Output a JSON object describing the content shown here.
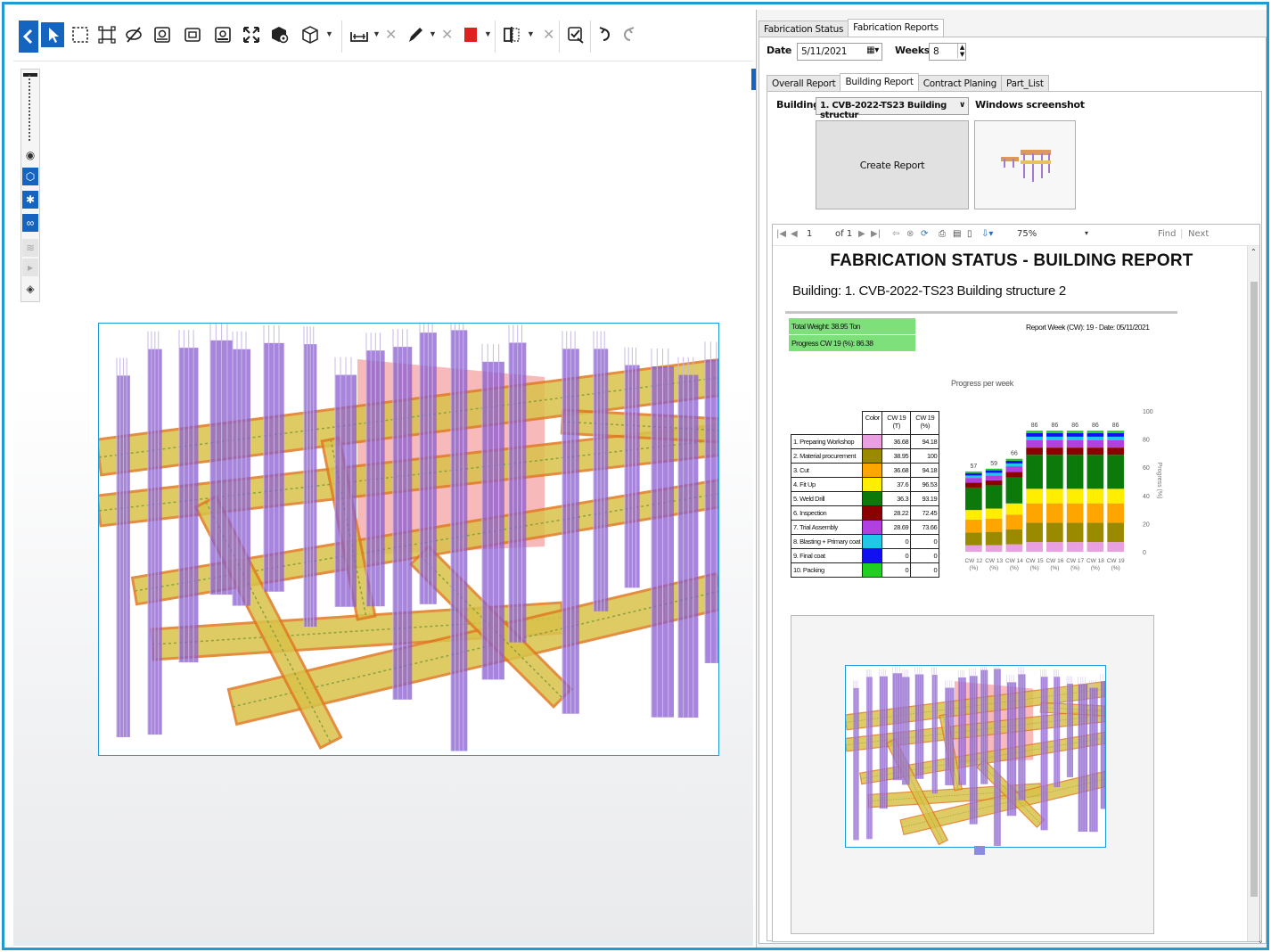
{
  "toolbar": {
    "icons": [
      "back-icon",
      "select-arrow-icon",
      "box-select-icon",
      "fit-selection-icon",
      "hide-icon",
      "section-box-icon",
      "section-plane-icon",
      "clip-icon",
      "fullscreen-icon",
      "object-settings-icon",
      "3d-box-icon",
      "measure-icon",
      "markup-pen-icon",
      "color-swatch-icon",
      "compare-icon",
      "check-icon",
      "undo-icon",
      "redo-icon"
    ],
    "swatch_color": "#e02020"
  },
  "panel": {
    "top_tabs": [
      "Fabrication Status",
      "Fabrication Reports"
    ],
    "date_label": "Date",
    "date_value": "5/11/2021",
    "weeks_label": "Weeks",
    "weeks_value": "8",
    "sub_tabs": [
      "Overall Report",
      "Building Report",
      "Contract Planing",
      "Part_List"
    ],
    "building_label": "Building",
    "building_value": "1. CVB-2022-TS23 Building structur",
    "screenshot_label": "Windows screenshot",
    "create_report_label": "Create Report"
  },
  "report_toolbar": {
    "page": "1",
    "of_pages": "of 1",
    "zoom": "75%",
    "find_label": "Find",
    "next_label": "Next"
  },
  "report": {
    "title": "FABRICATION STATUS - BUILDING REPORT",
    "building_line": "Building:   1. CVB-2022-TS23 Building structure 2",
    "total_weight": "Total Weight: 38.95 Ton",
    "progress": "Progress CW 19 (%): 86.38",
    "report_week": "Report Week (CW): 19 - Date: 05/11/2021",
    "table_headers": [
      "",
      "Color",
      "CW 19 (T)",
      "CW 19 (%)"
    ],
    "stages": [
      {
        "name": "1. Preparing Workshop",
        "color": "#e8a0e0",
        "t": "36.68",
        "p": "94.18"
      },
      {
        "name": "2. Material procurement",
        "color": "#9a8a00",
        "t": "38.95",
        "p": "100"
      },
      {
        "name": "3. Cut",
        "color": "#ffa500",
        "t": "36.68",
        "p": "94.18"
      },
      {
        "name": "4. Fit Up",
        "color": "#ffee00",
        "t": "37.6",
        "p": "96.53"
      },
      {
        "name": "5. Weld Drill",
        "color": "#0b7a0b",
        "t": "36.3",
        "p": "93.19"
      },
      {
        "name": "6. Inspection",
        "color": "#8b0000",
        "t": "28.22",
        "p": "72.45"
      },
      {
        "name": "7. Trial Assembly",
        "color": "#b040e0",
        "t": "28.69",
        "p": "73.66"
      },
      {
        "name": "8. Blasting + Primary coat",
        "color": "#20c8e8",
        "t": "0",
        "p": "0"
      },
      {
        "name": "9. Final coat",
        "color": "#1010f0",
        "t": "0",
        "p": "0"
      },
      {
        "name": "10. Packing",
        "color": "#20d020",
        "t": "0",
        "p": "0"
      }
    ]
  },
  "chart_data": {
    "type": "bar",
    "stacked": true,
    "title": "Progress per week",
    "ylabel": "Progress (%)",
    "ylim": [
      0,
      100
    ],
    "yticks": [
      0,
      20,
      40,
      60,
      80,
      100
    ],
    "categories": [
      "CW 12 (%)",
      "CW 13 (%)",
      "CW 14 (%)",
      "CW 15 (%)",
      "CW 16 (%)",
      "CW 17 (%)",
      "CW 18 (%)",
      "CW 19 (%)"
    ],
    "totals": [
      57,
      59,
      66,
      86,
      86,
      86,
      86,
      86
    ],
    "series_colors": [
      "#e8a0e0",
      "#9a8a00",
      "#ffa500",
      "#ffee00",
      "#0b7a0b",
      "#8b0000",
      "#b040e0",
      "#20c8e8",
      "#1010f0",
      "#20d020"
    ]
  }
}
